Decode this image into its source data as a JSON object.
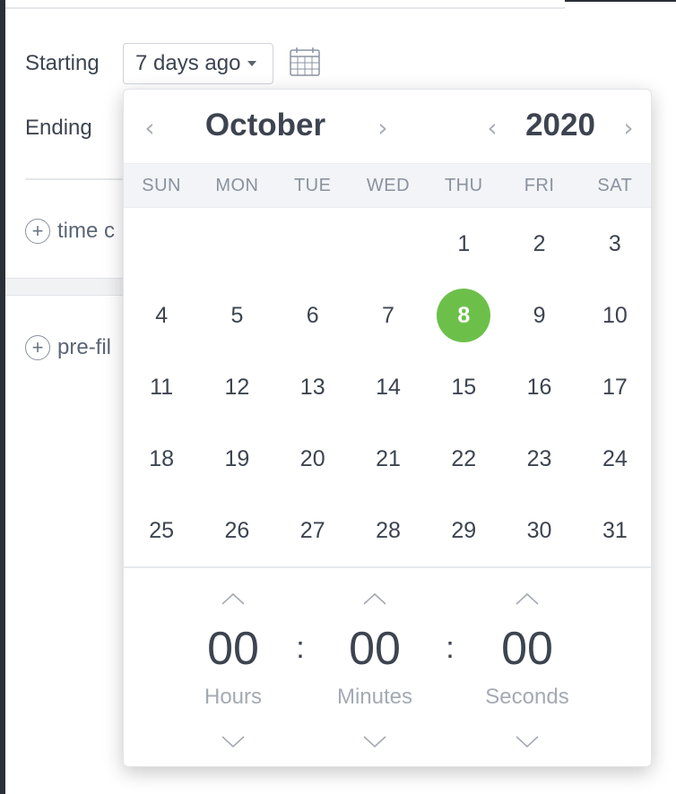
{
  "filter": {
    "starting_label": "Starting",
    "starting_value": "7 days ago",
    "ending_label": "Ending",
    "add_time_label": "time c",
    "add_prefilter_label": "pre-fil"
  },
  "calendar": {
    "month": "October",
    "year": "2020",
    "prev_arrow": "‹",
    "next_arrow": "›",
    "weekdays": [
      "SUN",
      "MON",
      "TUE",
      "WED",
      "THU",
      "FRI",
      "SAT"
    ],
    "selected_day": "8",
    "selected_color": "#6cc04a",
    "days": [
      "",
      "",
      "",
      "",
      "1",
      "2",
      "3",
      "4",
      "5",
      "6",
      "7",
      "8",
      "9",
      "10",
      "11",
      "12",
      "13",
      "14",
      "15",
      "16",
      "17",
      "18",
      "19",
      "20",
      "21",
      "22",
      "23",
      "24",
      "25",
      "26",
      "27",
      "28",
      "29",
      "30",
      "31"
    ]
  },
  "time": {
    "hours": "00",
    "minutes": "00",
    "seconds": "00",
    "hours_label": "Hours",
    "minutes_label": "Minutes",
    "seconds_label": "Seconds",
    "separator": ":"
  },
  "icons": {
    "calendar": "calendar-icon",
    "plus": "plus-circle-icon",
    "caret": "caret-down-icon",
    "chev_up": "chevron-up-icon",
    "chev_down": "chevron-down-icon"
  }
}
